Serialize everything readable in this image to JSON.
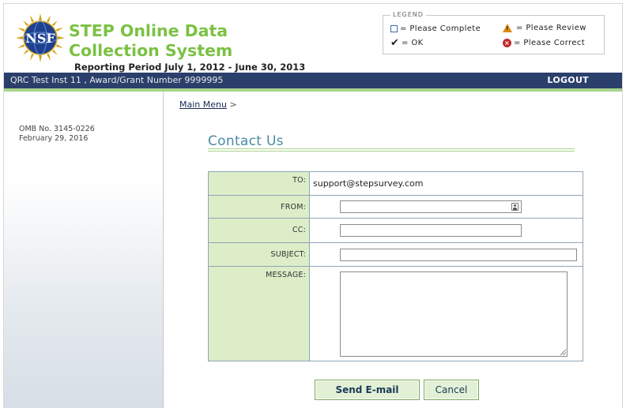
{
  "header": {
    "logo_text": "NSF",
    "app_title": "STEP Online Data Collection System",
    "reporting_period": "Reporting Period July 1, 2012 - June 30, 2013"
  },
  "legend": {
    "title": "LEGEND",
    "items": [
      {
        "icon": "empty-square-icon",
        "label": "= Please Complete"
      },
      {
        "icon": "warning-triangle-icon",
        "label": "= Please Review"
      },
      {
        "icon": "checkmark-icon",
        "label": "= OK"
      },
      {
        "icon": "error-circle-icon",
        "label": "= Please Correct"
      }
    ],
    "colors": {
      "complete": "#3a6ea5",
      "review": "#e08a10",
      "correct": "#c0282c"
    }
  },
  "navbar": {
    "award": "QRC Test Inst 11 , Award/Grant Number 9999995",
    "logout": "LOGOUT"
  },
  "sidebar": {
    "omb_number": "OMB No. 3145-0226",
    "omb_date": "February 29, 2016"
  },
  "breadcrumb": {
    "link": "Main Menu",
    "separator": ">"
  },
  "page_title": "Contact Us",
  "form": {
    "to_label": "TO:",
    "to_value": "support@stepsurvey.com",
    "from_label": "FROM:",
    "from_value": "",
    "cc_label": "CC:",
    "cc_value": "",
    "subject_label": "SUBJECT:",
    "subject_value": "",
    "message_label": "MESSAGE:",
    "message_value": ""
  },
  "buttons": {
    "send": "Send E-mail",
    "cancel": "Cancel"
  },
  "colors": {
    "title_green": "#7bc143",
    "nav_blue": "#2b3f6b",
    "label_bg": "#dcedc8",
    "page_title": "#4a8aa5"
  }
}
